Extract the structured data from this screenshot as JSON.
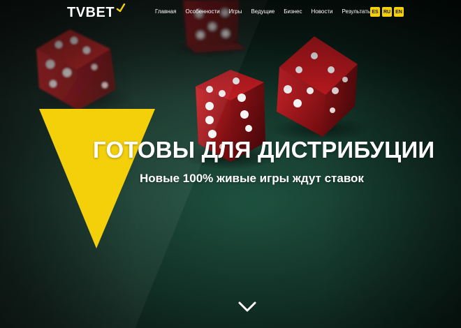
{
  "brand": {
    "name": "TVBET",
    "accent_color": "#f4d00b"
  },
  "nav": {
    "items": [
      {
        "label": "Главная"
      },
      {
        "label": "Особенности"
      },
      {
        "label": "Игры"
      },
      {
        "label": "Ведущие"
      },
      {
        "label": "Бизнес"
      },
      {
        "label": "Новости"
      },
      {
        "label": "Результаты"
      }
    ]
  },
  "languages": [
    "ES",
    "RU",
    "EN"
  ],
  "hero": {
    "headline": "ГОТОВЫ ДЛЯ ДИСТРИБУЦИИ",
    "subheadline": "Новые 100% живые игры ждут ставок",
    "background": "red-dice-on-green-felt",
    "scroll_icon": "chevron-down-icon"
  },
  "colors": {
    "felt": "#153a2d",
    "dice": "#b01016",
    "text": "#ffffff"
  }
}
